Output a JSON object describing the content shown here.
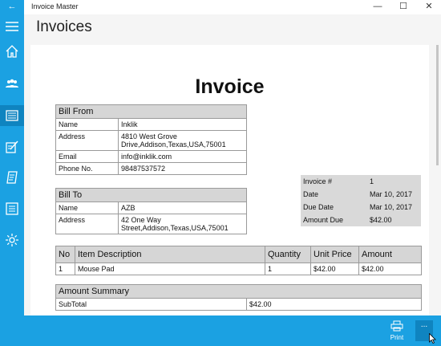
{
  "app": {
    "title": "Invoice Master",
    "back_icon": "←",
    "minimize_icon": "—",
    "maximize_icon": "☐",
    "close_icon": "✕"
  },
  "header": {
    "title": "Invoices"
  },
  "sidebar": {
    "items": [
      {
        "icon": "home-icon"
      },
      {
        "icon": "people-icon"
      },
      {
        "icon": "invoice-list-icon",
        "selected": true
      },
      {
        "icon": "edit-icon"
      },
      {
        "icon": "receipt-icon"
      },
      {
        "icon": "list-icon"
      },
      {
        "icon": "settings-icon"
      }
    ],
    "accent": "#1ba1e2"
  },
  "invoice": {
    "title": "Invoice",
    "bill_from": {
      "heading": "Bill From",
      "rows": [
        {
          "label": "Name",
          "value": "Inklik"
        },
        {
          "label": "Address",
          "value_line1": "4810 West Grove",
          "value_line2": "Drive,Addison,Texas,USA,75001"
        },
        {
          "label": "Email",
          "value": "info@inklik.com"
        },
        {
          "label": "Phone No.",
          "value": "98487537572"
        }
      ]
    },
    "bill_to": {
      "heading": "Bill To",
      "rows": [
        {
          "label": "Name",
          "value": "AZB"
        },
        {
          "label": "Address",
          "value_line1": "42 One Way",
          "value_line2": "Street,Addison,Texas,USA,75001"
        }
      ]
    },
    "meta": [
      {
        "label": "Invoice #",
        "value": "1"
      },
      {
        "label": "Date",
        "value": "Mar 10, 2017"
      },
      {
        "label": "Due Date",
        "value": "Mar 10, 2017"
      },
      {
        "label": "Amount Due",
        "value": "$42.00"
      }
    ],
    "items": {
      "columns": [
        "No",
        "Item Description",
        "Quantity",
        "Unit Price",
        "Amount"
      ],
      "rows": [
        [
          "1",
          "Mouse Pad",
          "1",
          "$42.00",
          "$42.00"
        ]
      ]
    },
    "summary": {
      "heading": "Amount Summary",
      "rows": [
        {
          "label": "SubTotal",
          "value": "$42.00"
        }
      ]
    }
  },
  "bottombar": {
    "print_label": "Print",
    "more_label": "..."
  }
}
